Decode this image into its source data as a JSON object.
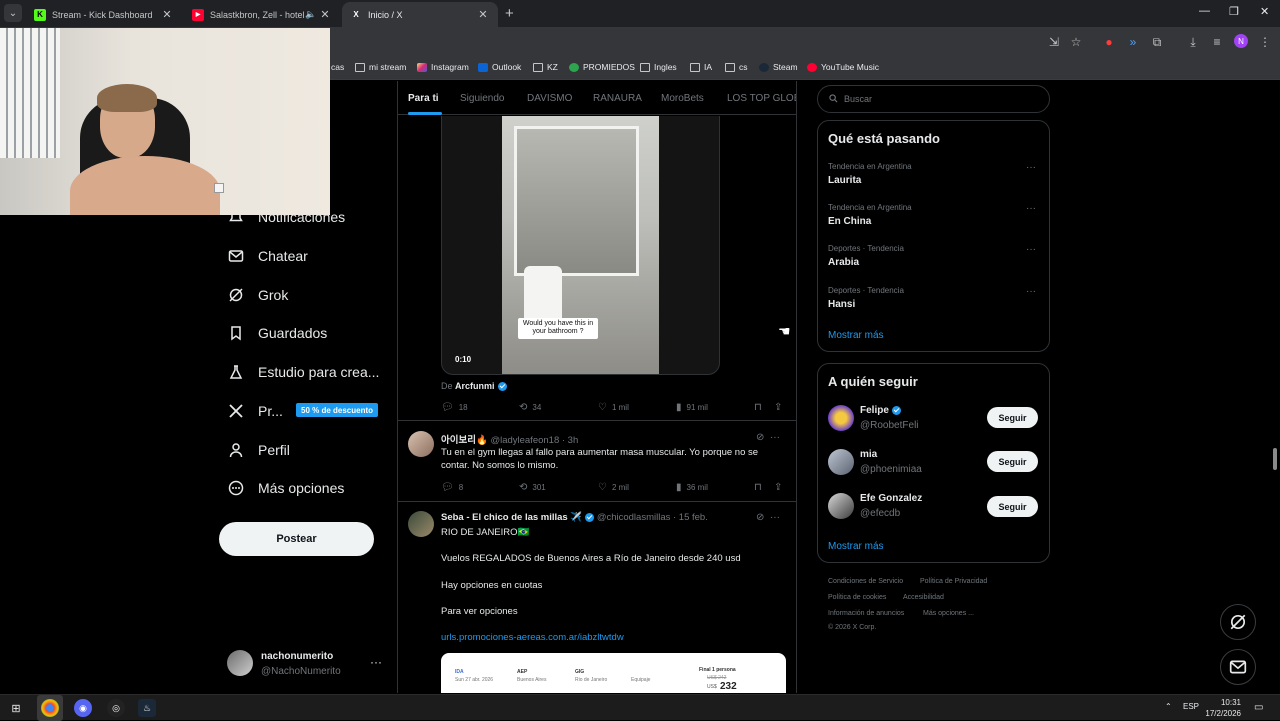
{
  "browser": {
    "tabs": [
      {
        "title": "Stream - Kick Dashboard",
        "favicon": "K"
      },
      {
        "title": "Salastkbron, Zell - hoteles (",
        "favicon": "▶"
      },
      {
        "title": "Inicio / X",
        "favicon": "X"
      }
    ],
    "bookmarks": [
      "cas",
      "mi stream",
      "Instagram",
      "Outlook",
      "KZ",
      "PROMIEDOS",
      "Ingles",
      "IA",
      "cs",
      "Steam",
      "YouTube Music"
    ],
    "profile_initial": "N"
  },
  "nav": {
    "items": [
      "Notificaciones",
      "Chatear",
      "Grok",
      "Guardados",
      "Estudio para crea...",
      "Pr...",
      "Perfil",
      "Más opciones"
    ],
    "premium_badge": "50 % de descuento",
    "post_button": "Postear",
    "account": {
      "name": "nachonumerito",
      "handle": "@NachoNumerito"
    }
  },
  "feed": {
    "tabs": [
      "Para ti",
      "Siguiendo",
      "DAVISMO",
      "RANAURA",
      "MoroBets",
      "LOS TOP GLOBA"
    ],
    "video": {
      "caption": "Would you have this in your bathroom ?",
      "duration": "0:10"
    },
    "via_prefix": "De",
    "via_account": "Arcfunmi",
    "tweet1_stats": {
      "replies": "18",
      "reposts": "34",
      "likes": "1 mil",
      "views": "91 mil"
    },
    "tweet2": {
      "name": "아이보리🔥",
      "handle": "@ladyleafeon18 · 3h",
      "text": "Tu en el gym llegas al fallo para aumentar masa muscular. Yo porque no se contar. No somos lo mismo.",
      "stats": {
        "replies": "8",
        "reposts": "301",
        "likes": "2 mil",
        "views": "36 mil"
      }
    },
    "tweet3": {
      "name": "Seba - El chico de las millas ✈️",
      "handle": "@chicodlasmillas · 15 feb.",
      "line1": "RIO DE JANEIRO🇧🇷",
      "line2": "Vuelos REGALADOS de Buenos Aires a Río de Janeiro desde 240 usd",
      "line3": "Hay opciones en cuotas",
      "line4": "Para ver opciones",
      "link": "urls.promociones-aereas.com.ar/iabzltwtdw",
      "card": {
        "ida": "IDA",
        "date": "Sun 27 abr. 2026",
        "from": "AEP",
        "from_city": "Buenos Aires",
        "to": "GIG",
        "to_city": "Rio de Janeiro",
        "bag": "Equipaje",
        "price_label": "Final 1 persona",
        "old_price": "US$ 242",
        "currency": "US$",
        "price": "232"
      }
    }
  },
  "sidebar": {
    "search_placeholder": "Buscar",
    "trends_title": "Qué está pasando",
    "trends": [
      {
        "category": "Tendencia en Argentina",
        "name": "Laurita"
      },
      {
        "category": "Tendencia en Argentina",
        "name": "En China"
      },
      {
        "category": "Deportes · Tendencia",
        "name": "Arabia"
      },
      {
        "category": "Deportes · Tendencia",
        "name": "Hansi"
      }
    ],
    "show_more": "Mostrar más",
    "follow_title": "A quién seguir",
    "follow": [
      {
        "name": "Felipe",
        "handle": "@RoobetFeli"
      },
      {
        "name": "mia",
        "handle": "@phoenimiaa"
      },
      {
        "name": "Efe Gonzalez",
        "handle": "@efecdb"
      }
    ],
    "follow_button": "Seguir",
    "footer": [
      "Condiciones de Servicio",
      "Política de Privacidad",
      "Política de cookies",
      "Accesibilidad",
      "Información de anuncios",
      "Más opciones ...",
      "© 2026 X Corp."
    ]
  },
  "taskbar": {
    "lang": "ESP",
    "time": "10:31",
    "date": "17/2/2026"
  },
  "colors": {
    "accent": "#1d9bf0",
    "background": "#000000",
    "border": "#2f3336"
  }
}
